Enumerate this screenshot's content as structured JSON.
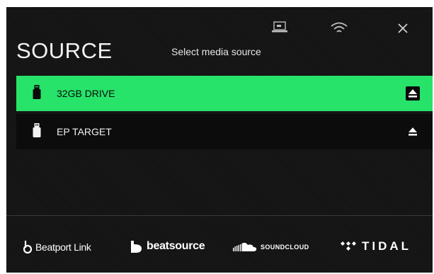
{
  "header": {
    "title": "SOURCE",
    "subtitle": "Select media source",
    "icons": [
      "laptop-icon",
      "wifi-icon",
      "close-icon"
    ]
  },
  "sources": [
    {
      "label": "32GB DRIVE",
      "selected": true,
      "icon": "usb-drive-icon",
      "action_icon": "eject-icon"
    },
    {
      "label": "EP TARGET",
      "selected": false,
      "icon": "usb-drive-icon",
      "action_icon": "eject-icon"
    }
  ],
  "services": {
    "beatport": "Beatport Link",
    "beatsource": "beatsource",
    "soundcloud": "SOUNDCLOUD",
    "tidal": "TIDAL"
  },
  "colors": {
    "background": "#141414",
    "selected_row": "#27e36a",
    "row": "#0c0c0c",
    "text": "#f2f2f2"
  }
}
